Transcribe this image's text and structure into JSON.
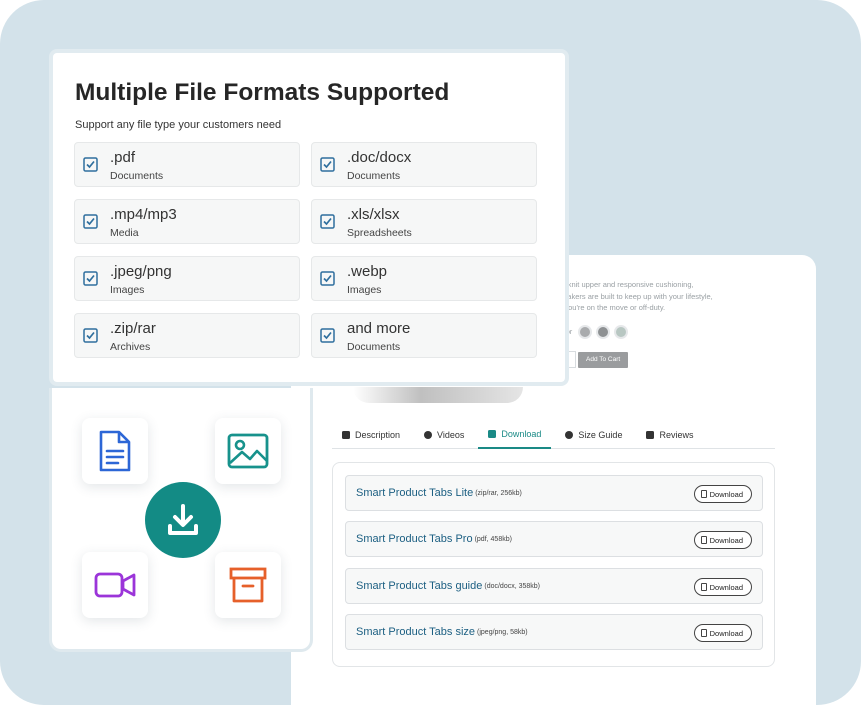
{
  "formats_card": {
    "title": "Multiple File Formats Supported",
    "subtitle": "Support any file type your customers need",
    "items": [
      {
        "ext": ".pdf",
        "type": "Documents"
      },
      {
        "ext": ".doc/docx",
        "type": "Documents"
      },
      {
        "ext": ".mp4/mp3",
        "type": "Media"
      },
      {
        "ext": ".xls/xlsx",
        "type": "Spreadsheets"
      },
      {
        "ext": ".jpeg/png",
        "type": "Images"
      },
      {
        "ext": ".webp",
        "type": "Images"
      },
      {
        "ext": ".zip/rar",
        "type": "Archives"
      },
      {
        "ext": "and more",
        "type": "Documents"
      }
    ]
  },
  "product": {
    "description_lines": [
      "athable knit upper and responsive cushioning,",
      "ese sneakers are built to keep up with your lifestyle,",
      "hether you're on the move or off-duty."
    ],
    "color_or": "or",
    "swatches": [
      "#a9abad",
      "#8e9193",
      "#b8c7c2"
    ],
    "add_to_cart": "Add To Cart"
  },
  "tabs": [
    {
      "label": "Description",
      "icon": "document-icon",
      "active": false
    },
    {
      "label": "Videos",
      "icon": "play-icon",
      "active": false
    },
    {
      "label": "Download",
      "icon": "download-icon",
      "active": true
    },
    {
      "label": "Size Guide",
      "icon": "info-icon",
      "active": false
    },
    {
      "label": "Reviews",
      "icon": "star-icon",
      "active": false
    }
  ],
  "downloads": {
    "button_label": "Download",
    "items": [
      {
        "name": "Smart Product Tabs Lite",
        "meta": "(zip/rar, 256kb)"
      },
      {
        "name": "Smart Product Tabs Pro",
        "meta": "(pdf, 458kb)"
      },
      {
        "name": "Smart Product Tabs guide",
        "meta": "(doc/docx, 358kb)"
      },
      {
        "name": "Smart Product Tabs size",
        "meta": "(jpeg/png, 58kb)"
      }
    ]
  },
  "icons": [
    "document-icon",
    "image-icon",
    "download-icon",
    "video-icon",
    "archive-icon"
  ],
  "colors": {
    "background": "#d3e2ea",
    "accent": "#138b85",
    "document_icon": "#2c66d6",
    "image_icon": "#17928c",
    "video_icon": "#9b35d9",
    "archive_icon": "#e6602a",
    "checkbox": "#2f6f9e"
  }
}
